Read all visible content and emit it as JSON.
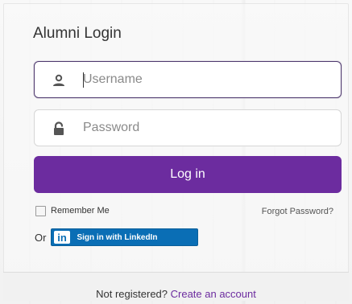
{
  "form": {
    "title": "Alumni Login",
    "username": {
      "placeholder": "Username",
      "value": ""
    },
    "password": {
      "placeholder": "Password",
      "value": ""
    },
    "login_label": "Log in",
    "remember_label": "Remember Me",
    "remember_checked": false,
    "forgot_label": "Forgot Password?"
  },
  "social": {
    "or_label": "Or",
    "linkedin_logo": "in",
    "linkedin_label": "Sign in with LinkedIn"
  },
  "footer": {
    "prompt": "Not registered?",
    "create_label": "Create an account"
  },
  "colors": {
    "accent": "#6c2c9f",
    "linkedin": "#0a6eb5",
    "focus_border": "#4f3a6f"
  },
  "icons": {
    "username": "user-icon",
    "password": "lock-icon"
  }
}
